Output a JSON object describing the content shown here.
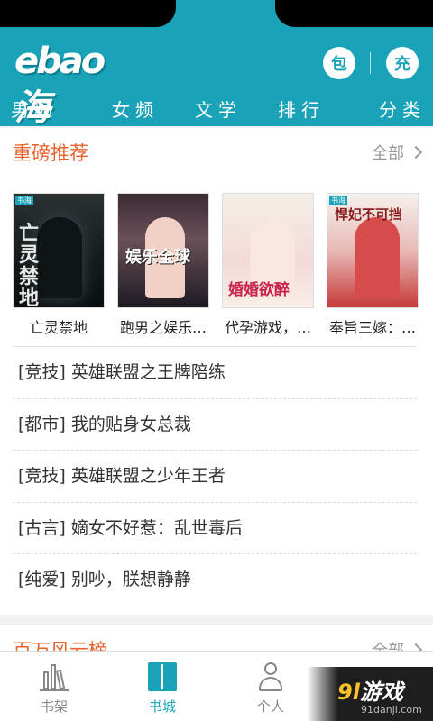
{
  "app": {
    "logo_text": "ebao海",
    "header_buttons": {
      "bao": "包",
      "chong": "充"
    }
  },
  "nav": [
    "男频",
    "女频",
    "文学",
    "排行",
    "分类"
  ],
  "featured": {
    "title": "重磅推荐",
    "more": "全部",
    "books": [
      {
        "title": "亡灵禁地",
        "cover_text": "亡灵禁地"
      },
      {
        "title": "跑男之娱乐…",
        "cover_text": "娱乐全球"
      },
      {
        "title": "代孕游戏，…",
        "cover_text": "婚婚欲醉"
      },
      {
        "title": "奉旨三嫁：…",
        "cover_text": "悍妃不可挡"
      }
    ],
    "list": [
      "[竞技] 英雄联盟之王牌陪练",
      "[都市] 我的贴身女总裁",
      "[竞技] 英雄联盟之少年王者",
      "[古言] 嫡女不好惹：乱世毒后",
      "[纯爱] 别吵，朕想静静"
    ]
  },
  "second_section": {
    "title": "百万风云榜",
    "more": "全部"
  },
  "tabbar": [
    {
      "label": "书架",
      "icon": "bookshelf-icon",
      "active": false
    },
    {
      "label": "书城",
      "icon": "book-open-icon",
      "active": true
    },
    {
      "label": "个人",
      "icon": "person-icon",
      "active": false
    },
    {
      "label": "",
      "icon": "more-icon",
      "active": false
    }
  ],
  "watermark": {
    "logo_num": "9l",
    "logo_text": "游戏",
    "url": "91danji.com"
  },
  "colors": {
    "brand": "#1aa3b8",
    "accent": "#e8622c"
  }
}
